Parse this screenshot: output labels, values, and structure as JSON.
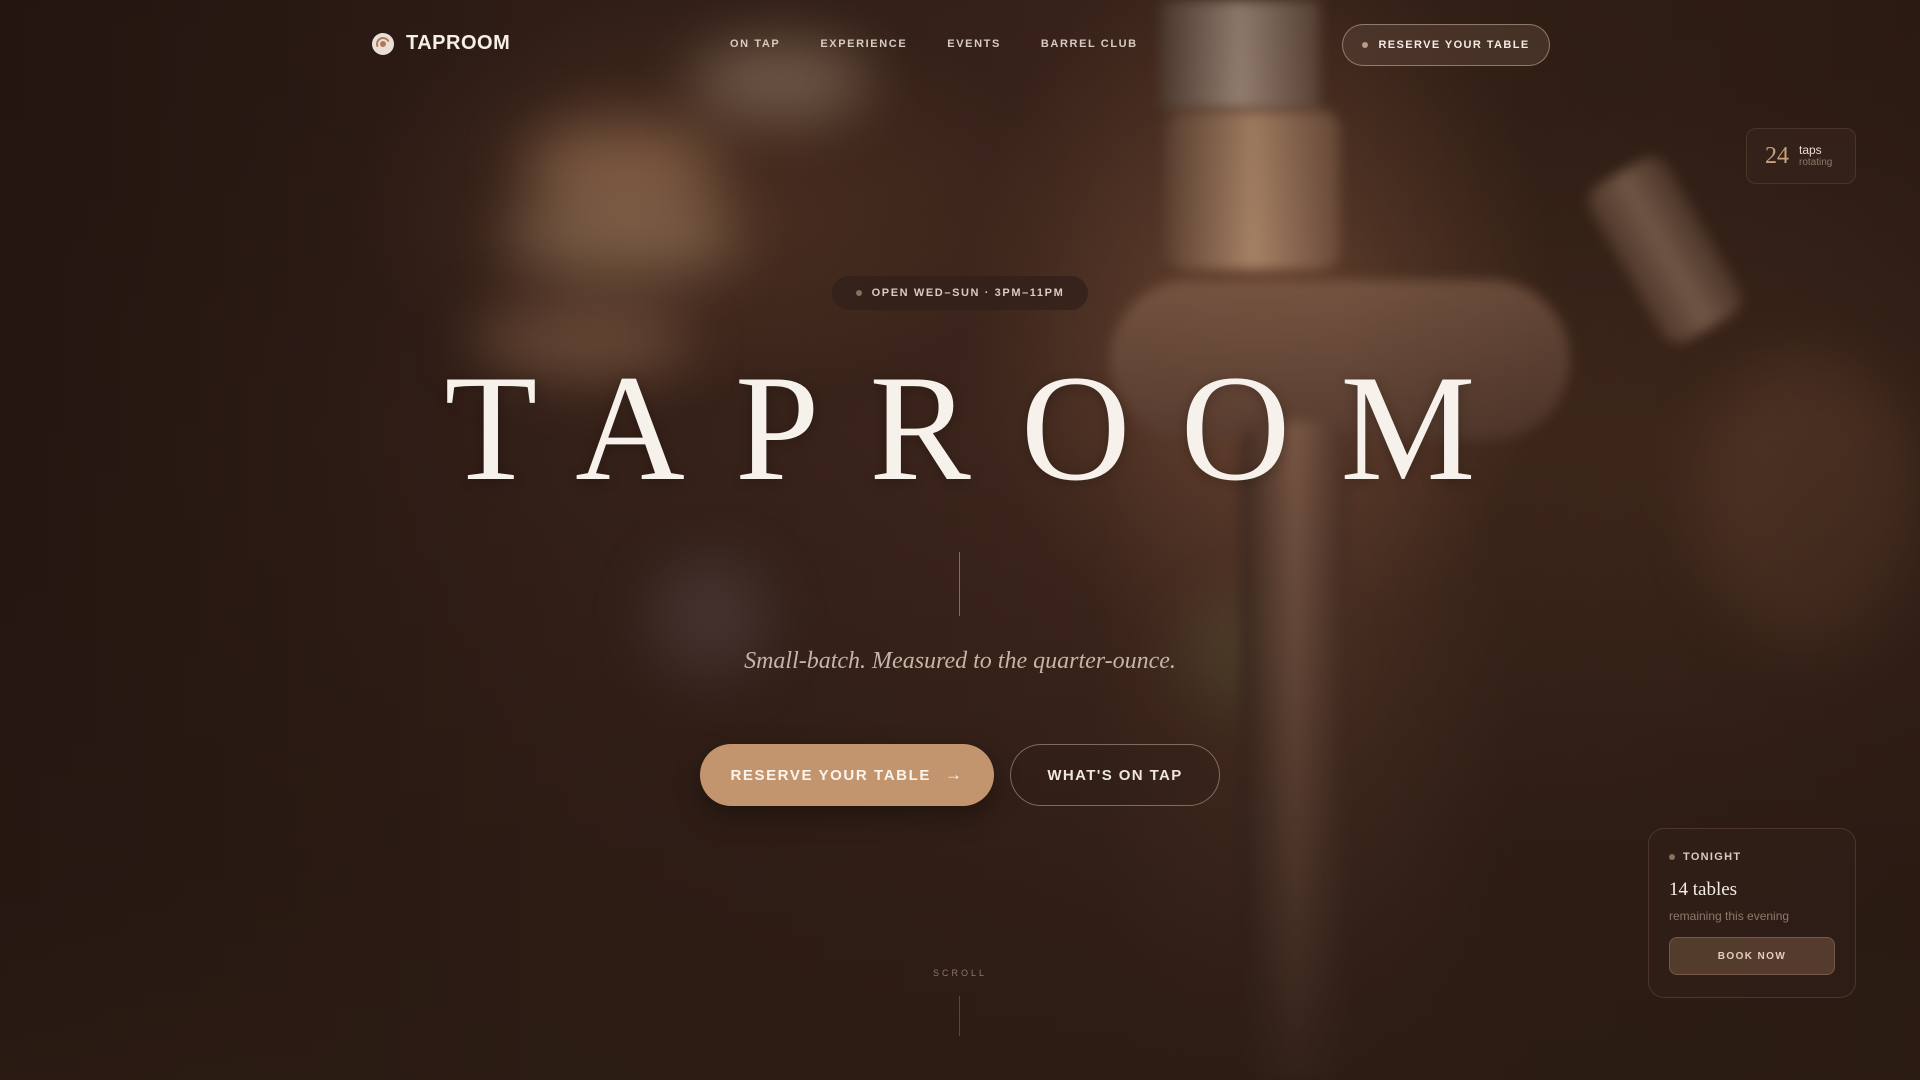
{
  "nav": {
    "brand": "TAPROOM",
    "links": [
      "ON TAP",
      "EXPERIENCE",
      "EVENTS",
      "BARREL CLUB"
    ],
    "cta": "RESERVE YOUR TABLE"
  },
  "taps": {
    "count": "24",
    "label": "taps",
    "sub": "rotating"
  },
  "hero": {
    "hours": "OPEN WED–SUN · 3PM–11PM",
    "title": "TAPROOM",
    "tagline": "Small-batch. Measured to the quarter-ounce.",
    "primary_cta": "RESERVE YOUR TABLE",
    "secondary_cta": "WHAT'S ON TAP",
    "scroll": "SCROLL"
  },
  "tonight": {
    "label": "TONIGHT",
    "count": "14 tables",
    "sub": "remaining this evening",
    "button": "BOOK NOW"
  },
  "colors": {
    "accent": "#c3956f",
    "background": "#2a1a14"
  }
}
